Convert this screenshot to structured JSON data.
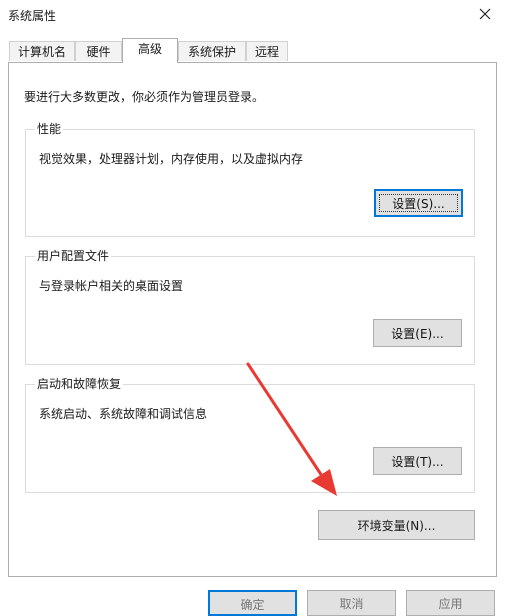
{
  "window": {
    "title": "系统属性",
    "close_icon": "close-icon"
  },
  "tabs": [
    {
      "label": "计算机名"
    },
    {
      "label": "硬件"
    },
    {
      "label": "高级",
      "active": true
    },
    {
      "label": "系统保护"
    },
    {
      "label": "远程"
    }
  ],
  "admin_note": "要进行大多数更改，你必须作为管理员登录。",
  "performance": {
    "legend": "性能",
    "description": "视觉效果，处理器计划，内存使用，以及虚拟内存",
    "button": "设置(S)..."
  },
  "user_profiles": {
    "legend": "用户配置文件",
    "description": "与登录帐户相关的桌面设置",
    "button": "设置(E)..."
  },
  "startup_recovery": {
    "legend": "启动和故障恢复",
    "description": "系统启动、系统故障和调试信息",
    "button": "设置(T)..."
  },
  "env_button": "环境变量(N)...",
  "bottom_buttons": [
    {
      "label": "确定"
    },
    {
      "label": "取消"
    },
    {
      "label": "应用"
    }
  ],
  "annotation": {
    "arrow_color": "#e83a33"
  }
}
